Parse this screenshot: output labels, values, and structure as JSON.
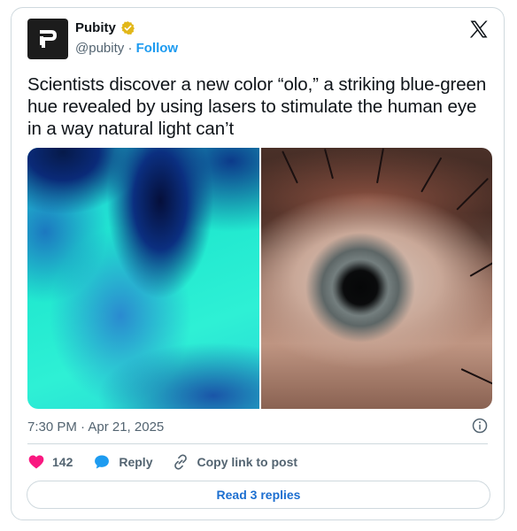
{
  "tweet": {
    "author": {
      "name": "Pubity",
      "handle": "@pubity",
      "separator": "·",
      "follow_label": "Follow",
      "verified": true,
      "avatar_letter": "P"
    },
    "text": "Scientists discover a new color “olo,” a striking blue-green hue revealed by using lasers to stimulate the human eye in a way natural light can’t",
    "timestamp": "7:30 PM · Apr 21, 2025",
    "likes_count": "142",
    "reply_label": "Reply",
    "copy_link_label": "Copy link to post",
    "read_replies_label": "Read 3 replies",
    "icons": {
      "platform": "x-logo-icon",
      "verified": "verified-badge-icon",
      "info": "info-icon",
      "like": "heart-icon",
      "reply": "reply-bubble-icon",
      "copy": "link-icon"
    }
  },
  "colors": {
    "like": "#f91880",
    "reply": "#1d9bf0",
    "link": "#1d9bf0",
    "verified_badge": "#e2b719",
    "text": "#0f1419",
    "muted": "#536471",
    "border": "#cfd9de"
  }
}
